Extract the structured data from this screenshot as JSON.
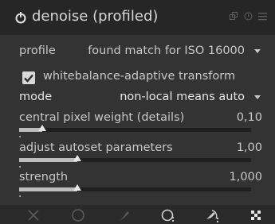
{
  "module": {
    "title": "denoise (profiled)",
    "icons": [
      "power-icon",
      "presets-icon",
      "reset-icon",
      "menu-icon"
    ]
  },
  "profile": {
    "label": "profile",
    "value": "found match for ISO 16000"
  },
  "checkbox": {
    "label": "whitebalance-adaptive transform",
    "checked": true
  },
  "mode": {
    "label": "mode",
    "value": "non-local means auto"
  },
  "sliders": [
    {
      "label": "central pixel weight (details)",
      "value": "0,10",
      "fraction": 0.1
    },
    {
      "label": "adjust autoset parameters",
      "value": "1,00",
      "fraction": 0.25
    },
    {
      "label": "strength",
      "value": "1,000",
      "fraction": 0.25
    }
  ],
  "footer": {
    "buttons": [
      "close-icon",
      "circle-icon",
      "brush-icon",
      "parametric-mask-icon",
      "drawn-parametric-icon",
      "raster-mask-icon"
    ]
  }
}
